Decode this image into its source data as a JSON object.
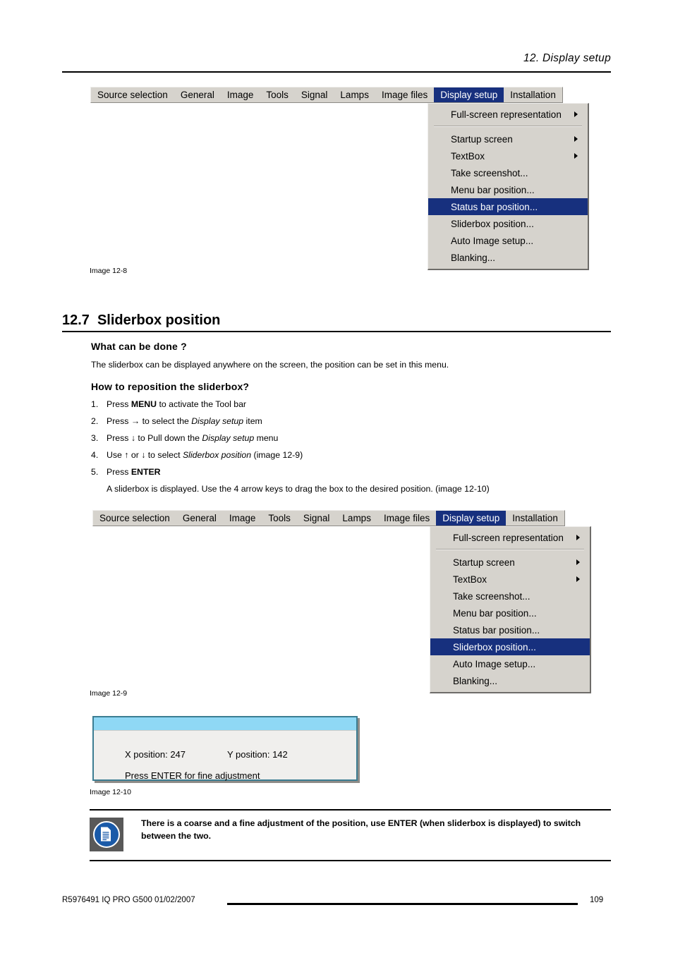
{
  "header": {
    "chapter_title": "12.  Display setup"
  },
  "osd_menubar_items": [
    "Source selection",
    "General",
    "Image",
    "Tools",
    "Signal",
    "Lamps",
    "Image files",
    "Display setup",
    "Installation"
  ],
  "osd_menu_items": [
    "Full-screen representation",
    "Startup screen",
    "TextBox",
    "Take screenshot...",
    "Menu bar position...",
    "Status bar position...",
    "Sliderbox position...",
    "Auto Image setup...",
    "Blanking..."
  ],
  "figure_1": {
    "caption": "Image 12-8",
    "selected_menubar_item": "Display setup",
    "highlighted_item": "Status bar position..."
  },
  "figure_2": {
    "caption": "Image 12-9",
    "selected_menubar_item": "Display setup",
    "highlighted_item": "Sliderbox position..."
  },
  "section": {
    "number": "12.7",
    "title": "Sliderbox position",
    "what_heading": "What can be done ?",
    "what_body": "The sliderbox can be displayed anywhere on the screen, the position can be set in this menu.",
    "how_heading": "How to reposition the sliderbox?",
    "steps": [
      {
        "num": "1.",
        "pre": "Press ",
        "bold": "MENU",
        "post": " to activate the Tool bar"
      },
      {
        "num": "2.",
        "pre": "Press → to select the ",
        "italic": "Display setup",
        "post": " item"
      },
      {
        "num": "3.",
        "pre": "Press ↓ to Pull down the ",
        "italic": "Display setup",
        "post": " menu"
      },
      {
        "num": "4.",
        "pre": "Use ↑ or ↓ to select ",
        "italic": "Sliderbox position",
        "post": " (image 12-9)"
      },
      {
        "num": "5.",
        "pre": "Press ",
        "bold": "ENTER",
        "post": ""
      }
    ],
    "step5_continuation": "A sliderbox is displayed.  Use the 4 arrow keys to drag the box to the desired position.  (image 12-10)"
  },
  "sliderbox": {
    "caption": "Image 12-10",
    "x_label": "X position: 247",
    "y_label": "Y position: 142",
    "hint": "Press ENTER for fine adjustment"
  },
  "note": {
    "icon": "note-document-icon",
    "text": "There is a coarse and a fine adjustment of the position, use ENTER (when sliderbox is displayed) to switch between the two."
  },
  "footer": {
    "left": "R5976491  IQ PRO G500  01/02/2007",
    "page": "109"
  },
  "colors": {
    "menu_highlight": "#17307e",
    "menu_face": "#d6d3cd",
    "sliderbox_title": "#8fd8f5",
    "sliderbox_border": "#3c7d92",
    "note_icon_blue": "#1a5aa8"
  }
}
